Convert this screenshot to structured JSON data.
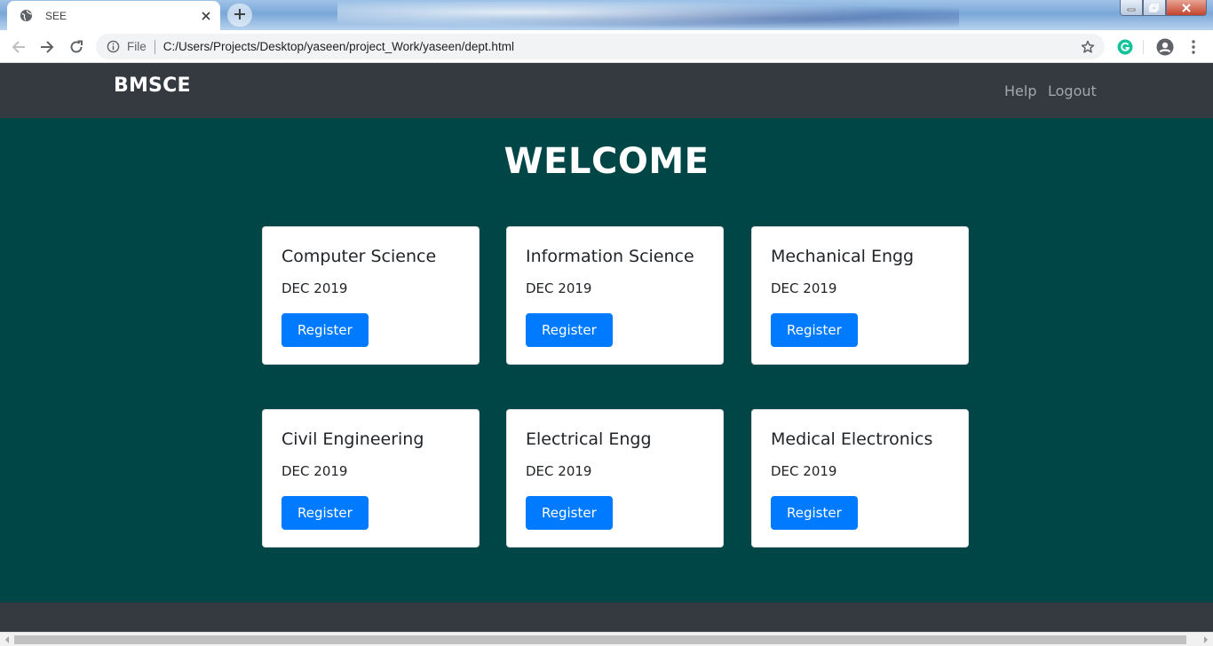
{
  "browser": {
    "tab_title": "SEE",
    "url_scheme": "File",
    "url": "C:/Users/Projects/Desktop/yaseen/project_Work/yaseen/dept.html",
    "icons": [
      "globe-icon",
      "close-icon",
      "plus-icon",
      "back-icon",
      "forward-icon",
      "reload-icon",
      "info-icon",
      "star-icon",
      "grammarly-icon",
      "profile-icon",
      "menu-icon"
    ],
    "accent_color": "#15c39a"
  },
  "navbar": {
    "brand": "BMSCE",
    "links": [
      "Help",
      "Logout"
    ]
  },
  "main": {
    "heading": "WELCOME",
    "background_color": "#004646",
    "cards": [
      {
        "title": "Computer Science",
        "date": "DEC 2019",
        "button": "Register"
      },
      {
        "title": "Information Science",
        "date": "DEC 2019",
        "button": "Register"
      },
      {
        "title": "Mechanical Engg",
        "date": "DEC 2019",
        "button": "Register"
      },
      {
        "title": "Civil Engineering",
        "date": "DEC 2019",
        "button": "Register"
      },
      {
        "title": "Electrical Engg",
        "date": "DEC 2019",
        "button": "Register"
      },
      {
        "title": "Medical Electronics",
        "date": "DEC 2019",
        "button": "Register"
      }
    ],
    "button_color": "#007bff"
  }
}
